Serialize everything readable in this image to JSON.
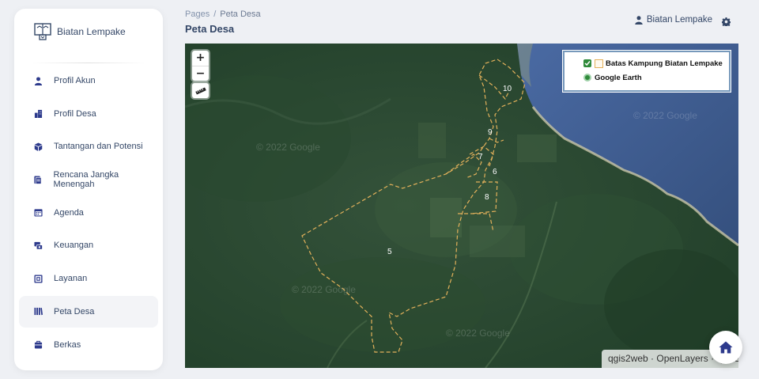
{
  "brand": {
    "name": "Biatan Lempake"
  },
  "sidebar": {
    "items": [
      {
        "label": "Profil Akun",
        "icon": "user-icon"
      },
      {
        "label": "Profil Desa",
        "icon": "building-icon"
      },
      {
        "label": "Tantangan dan Potensi",
        "icon": "cube-icon"
      },
      {
        "label": "Rencana Jangka Menengah",
        "icon": "document-icon"
      },
      {
        "label": "Agenda",
        "icon": "calendar-icon"
      },
      {
        "label": "Keuangan",
        "icon": "money-icon"
      },
      {
        "label": "Layanan",
        "icon": "service-icon"
      },
      {
        "label": "Peta Desa",
        "icon": "map-books-icon",
        "active": true
      },
      {
        "label": "Berkas",
        "icon": "bag-icon"
      }
    ]
  },
  "breadcrumb": {
    "root": "Pages",
    "separator": "/",
    "current": "Peta Desa"
  },
  "page": {
    "title": "Peta Desa"
  },
  "user": {
    "name": "Biatan Lempake"
  },
  "map": {
    "zoom_in": "+",
    "zoom_out": "−",
    "legend": {
      "boundary_label": "Batas Kampung Biatan Lempake",
      "base_label": "Google Earth"
    },
    "attribution": "qgis2web · OpenLayers · QGIS",
    "watermark": "© 2022 Google",
    "region_labels": [
      "5",
      "6",
      "7",
      "8",
      "9",
      "10"
    ],
    "colors": {
      "boundary": "#e3b15b",
      "forest": "#2c4a2e",
      "sea": "#3d5a8f"
    }
  }
}
